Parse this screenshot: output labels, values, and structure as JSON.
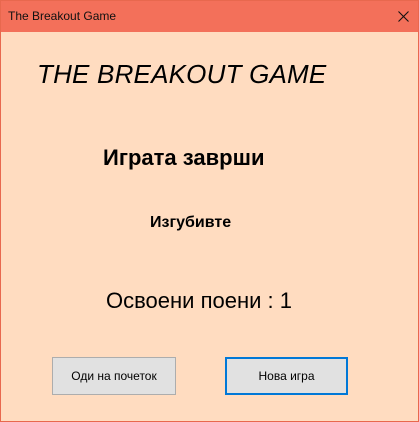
{
  "window": {
    "title": "The Breakout Game",
    "titlebar_color": "#f3705a",
    "background_color": "#ffdcc0",
    "close_icon": "close-icon"
  },
  "content": {
    "game_title": "THE BREAKOUT GAME",
    "status_heading": "Играта заврши",
    "result": "Изгубивте",
    "score_label": "Освоени поени :",
    "score_value": "1"
  },
  "buttons": {
    "home_label": "Оди на почеток",
    "new_game_label": "Нова игра",
    "focus_color": "#0078d7"
  }
}
